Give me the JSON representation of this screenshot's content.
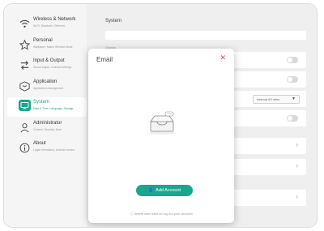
{
  "sidebar": {
    "items": [
      {
        "title": "Wireless & Network",
        "sub": "Wi-Fi, Bluetooth, Ethernet",
        "icon": "wifi-icon",
        "active": false
      },
      {
        "title": "Personal",
        "sub": "Wallpaper, Matrix Window Mode",
        "icon": "star-icon",
        "active": false
      },
      {
        "title": "Input & Output",
        "sub": "Sound output, Channel settings",
        "icon": "swap-icon",
        "active": false
      },
      {
        "title": "Application",
        "sub": "Application management",
        "icon": "box-icon",
        "active": false
      },
      {
        "title": "System",
        "sub": "Date & Time, Language, Storage",
        "icon": "monitor-icon",
        "active": true
      },
      {
        "title": "Administrator",
        "sub": "Content, Security, Boot",
        "icon": "user-icon",
        "active": false
      },
      {
        "title": "About",
        "sub": "Legal information, Android version",
        "icon": "info-icon",
        "active": false
      }
    ]
  },
  "content": {
    "title": "System",
    "section_label": "Display",
    "dropdown_value": "Interval 60 mins"
  },
  "modal": {
    "title": "Email",
    "close_glyph": "✕",
    "add_button_label": "Add Account",
    "footnote": "Delete user data on log out your account"
  },
  "colors": {
    "accent": "#1aa68e",
    "close": "#e0513c"
  }
}
